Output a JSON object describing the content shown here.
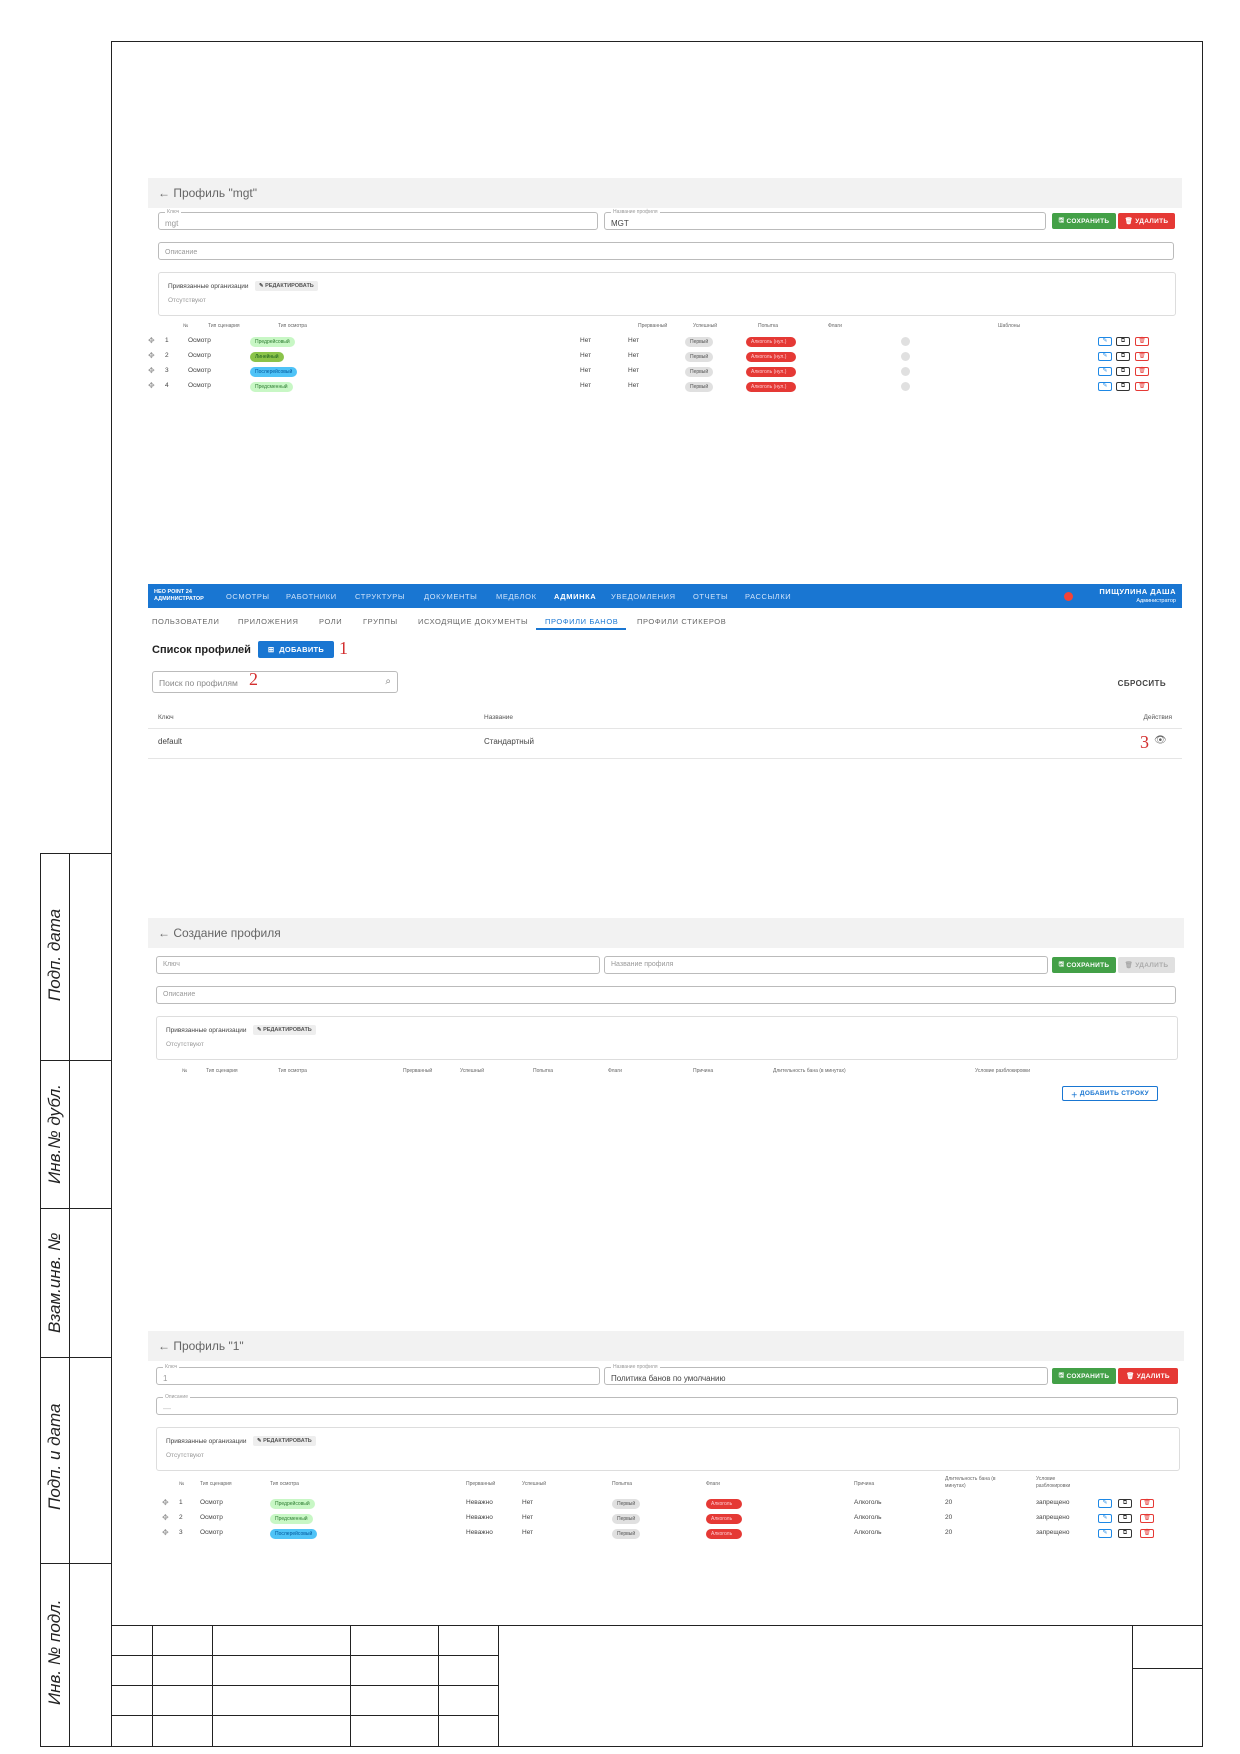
{
  "side_labels": [
    "Подп. дата",
    "Инв.№ дубл.",
    "Взам.инв. №",
    "Подп. и дата",
    "Инв. № подл."
  ],
  "shot1": {
    "title": "← Профиль \"mgt\"",
    "key_label": "Ключ",
    "key_value": "mgt",
    "name_label": "Название профиля",
    "name_value": "MGT",
    "save": "СОХРАНИТЬ",
    "delete": "УДАЛИТЬ",
    "description": "Описание",
    "orgs_title": "Привязанные организации",
    "orgs_edit": "РЕДАКТИРОВАТЬ",
    "orgs_none": "Отсутствуют",
    "headers": [
      "№",
      "Тип сценария",
      "Тип осмотра",
      "Прерванный",
      "Успешный",
      "Попытка",
      "Флаги",
      "Шаблоны"
    ],
    "rows": [
      {
        "n": "1",
        "scenario": "Осмотр",
        "type": "Предрейсовый",
        "interrupted": "Нет",
        "success": "Нет",
        "attempt": "Первый",
        "flag": "Алкоголь (нул.)"
      },
      {
        "n": "2",
        "scenario": "Осмотр",
        "type": "Линейный",
        "interrupted": "Нет",
        "success": "Нет",
        "attempt": "Первый",
        "flag": "Алкоголь (нул.)"
      },
      {
        "n": "3",
        "scenario": "Осмотр",
        "type": "Послерейсовый",
        "interrupted": "Нет",
        "success": "Нет",
        "attempt": "Первый",
        "flag": "Алкоголь (нул.)"
      },
      {
        "n": "4",
        "scenario": "Осмотр",
        "type": "Предсменный",
        "interrupted": "Нет",
        "success": "Нет",
        "attempt": "Первый",
        "flag": "Алкоголь (нул.)"
      }
    ]
  },
  "shot2": {
    "logo_top": "НЕО POINT 24",
    "logo_bottom": "АДМИНИСТРАТОР",
    "nav": [
      "ОСМОТРЫ",
      "РАБОТНИКИ",
      "СТРУКТУРЫ",
      "ДОКУМЕНТЫ",
      "МЕДБЛОК",
      "АДМИНКА",
      "УВЕДОМЛЕНИЯ",
      "ОТЧЕТЫ",
      "РАССЫЛКИ"
    ],
    "user_name": "ПИЩУЛИНА ДАША",
    "user_role": "Администратор",
    "subtabs": [
      "ПОЛЬЗОВАТЕЛИ",
      "ПРИЛОЖЕНИЯ",
      "РОЛИ",
      "ГРУППЫ",
      "ИСХОДЯЩИЕ ДОКУМЕНТЫ",
      "ПРОФИЛИ БАНОВ",
      "ПРОФИЛИ СТИКЕРОВ"
    ],
    "list_title": "Список профилей",
    "add": "ДОБАВИТЬ",
    "search_placeholder": "Поиск по профилям",
    "reset": "СБРОСИТЬ",
    "col_key": "Ключ",
    "col_name": "Название",
    "col_actions": "Действия",
    "row_key": "default",
    "row_name": "Стандартный",
    "marks": [
      "1",
      "2",
      "3"
    ]
  },
  "shot3": {
    "title": "← Создание профиля",
    "key_placeholder": "Ключ",
    "name_placeholder": "Название профиля",
    "save": "СОХРАНИТЬ",
    "delete": "УДАЛИТЬ",
    "description": "Описание",
    "orgs_title": "Привязанные организации",
    "orgs_edit": "РЕДАКТИРОВАТЬ",
    "orgs_none": "Отсутствуют",
    "headers": [
      "№",
      "Тип сценария",
      "Тип осмотра",
      "Прерванный",
      "Успешный",
      "Попытка",
      "Флаги",
      "Причина",
      "Длительность бана (в минутах)",
      "Условие разблокировки"
    ],
    "add_row": "ДОБАВИТЬ СТРОКУ"
  },
  "shot4": {
    "title": "← Профиль \"1\"",
    "key_label": "Ключ",
    "key_value": "1",
    "name_label": "Название профиля",
    "name_value": "Политика банов по умолчанию",
    "desc_label": "Описание",
    "desc_value": "—",
    "save": "СОХРАНИТЬ",
    "delete": "УДАЛИТЬ",
    "orgs_title": "Привязанные организации",
    "orgs_edit": "РЕДАКТИРОВАТЬ",
    "orgs_none": "Отсутствуют",
    "headers": [
      "№",
      "Тип сценария",
      "Тип осмотра",
      "Прерванный",
      "Успешный",
      "Попытка",
      "Флаги",
      "Причина",
      "Длительность бана (в минутах)",
      "Условие разблокировки"
    ],
    "rows": [
      {
        "n": "1",
        "scenario": "Осмотр",
        "type": "Предрейсовый",
        "interrupted": "Неважно",
        "success": "Нет",
        "attempt": "Первый",
        "flag": "Алкоголь",
        "reason": "Алкоголь",
        "duration": "20",
        "cond": "запрещено"
      },
      {
        "n": "2",
        "scenario": "Осмотр",
        "type": "Предсменный",
        "interrupted": "Неважно",
        "success": "Нет",
        "attempt": "Первый",
        "flag": "Алкоголь",
        "reason": "Алкоголь",
        "duration": "20",
        "cond": "запрещено"
      },
      {
        "n": "3",
        "scenario": "Осмотр",
        "type": "Послерейсовый",
        "interrupted": "Неважно",
        "success": "Нет",
        "attempt": "Первый",
        "flag": "Алкоголь",
        "reason": "Алкоголь",
        "duration": "20",
        "cond": "запрещено"
      }
    ]
  }
}
